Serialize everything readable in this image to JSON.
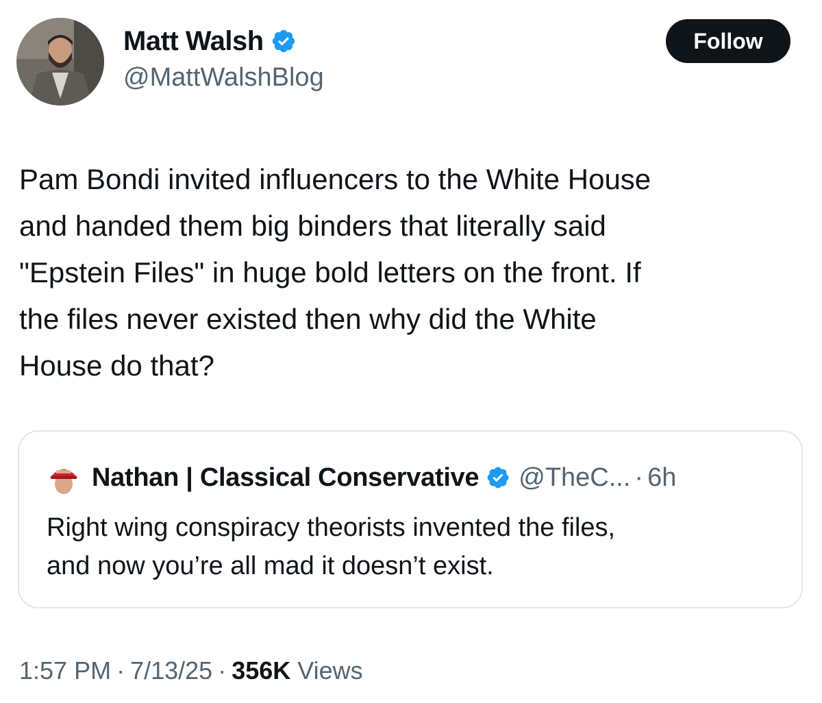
{
  "author": {
    "display_name": "Matt Walsh",
    "handle": "@MattWalshBlog",
    "verified": true
  },
  "follow_button": {
    "label": "Follow"
  },
  "tweet": {
    "text_lines": [
      "Pam Bondi invited influencers to the White House",
      "and handed them big binders that literally said",
      "\"Epstein Files\" in huge bold letters on the front. If",
      "the files never existed then why did the White",
      "House do that?"
    ]
  },
  "quoted_tweet": {
    "display_name": "Nathan | Classical Conservative",
    "handle": "@TheC...",
    "separator": "·",
    "time": "6h",
    "verified": true,
    "text_lines": [
      "Right wing conspiracy theorists invented the files,",
      "and now you’re all mad it doesn’t exist."
    ]
  },
  "meta": {
    "time": "1:57 PM",
    "date": "7/13/25",
    "separator": "·",
    "views_count": "356K",
    "views_label": "Views"
  },
  "colors": {
    "text_primary": "#0f1419",
    "text_secondary": "#536471",
    "verified_blue": "#1d9bf0",
    "border": "#e1e6ea",
    "follow_button_bg": "#0f1419"
  },
  "icons": {
    "verified": "verified-badge-icon"
  }
}
